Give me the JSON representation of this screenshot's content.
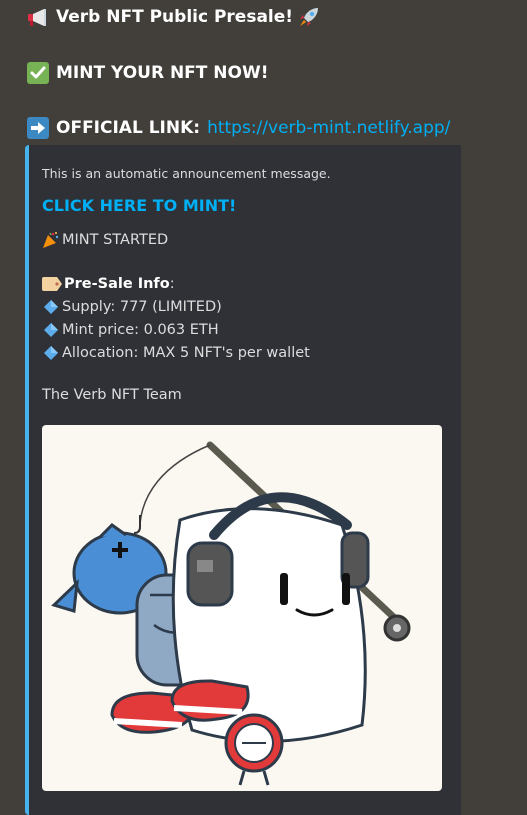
{
  "message": {
    "title_line": "Verb NFT Public Presale!",
    "mint_line": "MINT YOUR NFT NOW!",
    "official_label": "OFFICIAL LINK:",
    "official_url": "https://verb-mint.netlify.app/"
  },
  "embed": {
    "accent_color": "#45b4ec",
    "description_small": "This is an automatic announcement message.",
    "title_link": "CLICK HERE TO MINT!",
    "mint_started": "MINT STARTED",
    "presale_label": "Pre-Sale Info",
    "presale_colon": ":",
    "items": [
      "Supply: 777 (LIMITED)",
      "Mint price: 0.063 ETH",
      "Allocation: MAX 5 NFT's per wallet"
    ],
    "signature": "The Verb NFT Team"
  },
  "icons": {
    "megaphone": "megaphone-icon",
    "rocket": "rocket-icon",
    "check": "check-mark-button-icon",
    "arrow": "right-arrow-icon",
    "party": "party-popper-icon",
    "label": "label-tag-icon",
    "diamond": "blue-diamond-icon"
  },
  "colors": {
    "background": "#423f3a",
    "embed_bg": "#2f3136",
    "link": "#00aff4"
  }
}
